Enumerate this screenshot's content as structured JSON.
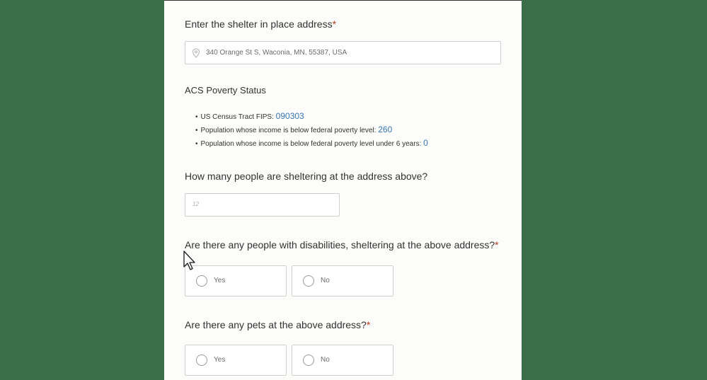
{
  "address_question": {
    "label": "Enter the shelter in place address",
    "required_mark": "*",
    "value": "340 Orange St S, Waconia, MN, 55387, USA",
    "icon": "location-pin-icon"
  },
  "poverty": {
    "title": "ACS Poverty Status",
    "items": [
      {
        "label": "US Census Tract FIPS: ",
        "value": "090303"
      },
      {
        "label": "Population whose income is below federal poverty level: ",
        "value": "260"
      },
      {
        "label": "Population whose income is below federal poverty level under 6 years: ",
        "value": "0"
      }
    ]
  },
  "people_question": {
    "label": "How many people are sheltering at the address above?",
    "value": "",
    "icon": "number-icon",
    "icon_glyph": "12"
  },
  "disabilities_question": {
    "label": "Are there any people with disabilities, sheltering at the above address?",
    "required_mark": "*",
    "options": [
      "Yes",
      "No"
    ]
  },
  "pets_question": {
    "label": "Are there any pets at the above address?",
    "required_mark": "*",
    "options": [
      "Yes",
      "No"
    ]
  },
  "colors": {
    "background": "#3b6e48",
    "panel": "#fcfcfa",
    "required": "#b53b21",
    "value_link": "#3777b3"
  }
}
